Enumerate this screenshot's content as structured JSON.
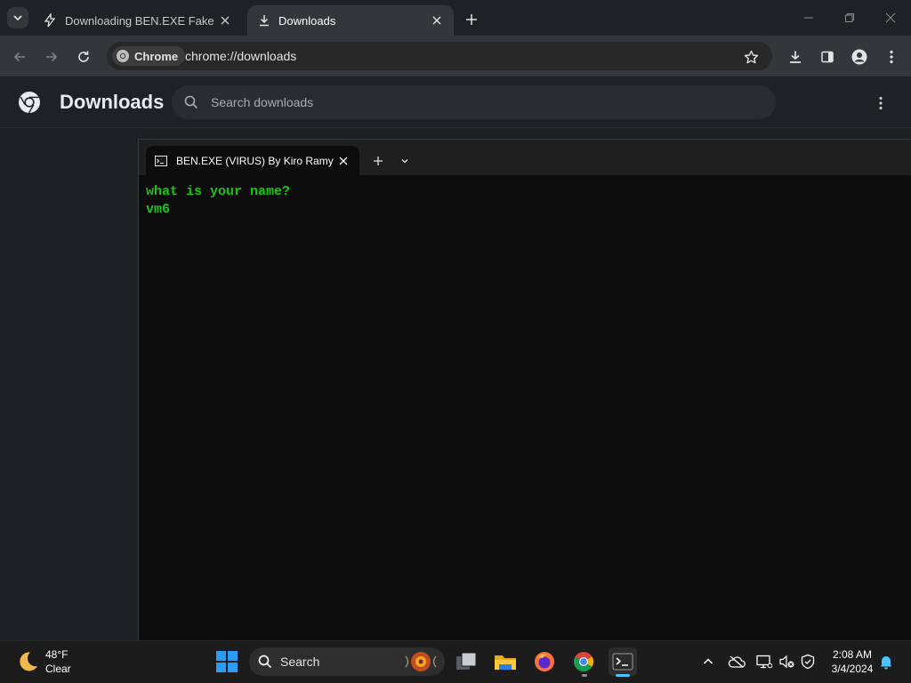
{
  "browser": {
    "tabs": [
      {
        "title": "Downloading BEN.EXE Fake Virus",
        "icon": "lightning-bolt-icon",
        "active": false
      },
      {
        "title": "Downloads",
        "icon": "download-icon",
        "active": true
      }
    ],
    "omnibox": {
      "chip_label": "Chrome",
      "url": "chrome://downloads"
    }
  },
  "downloads_page": {
    "title": "Downloads",
    "search_placeholder": "Search downloads"
  },
  "terminal": {
    "tab_title": "BEN.EXE (VIRUS) By Kiro Ramy",
    "lines": [
      "what is your name?",
      "vm6"
    ],
    "text_color": "#16c60c"
  },
  "taskbar": {
    "weather": {
      "temp": "48°F",
      "condition": "Clear"
    },
    "search_label": "Search",
    "clock": {
      "time": "2:08 AM",
      "date": "3/4/2024"
    }
  }
}
